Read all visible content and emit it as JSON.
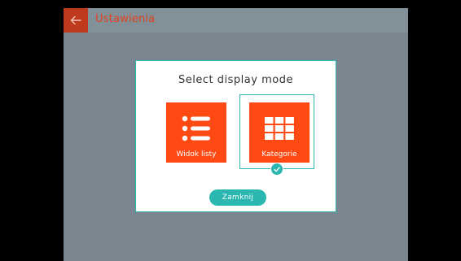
{
  "header": {
    "back_icon": "arrow-left-icon",
    "title": "Ustawienia"
  },
  "dialog": {
    "title": "Select display mode",
    "options": [
      {
        "label": "Widok listy",
        "icon": "list-icon",
        "selected": false
      },
      {
        "label": "Kategorie",
        "icon": "grid-icon",
        "selected": true
      }
    ],
    "selected_icon": "checkmark-icon",
    "close_label": "Zamknij"
  },
  "colors": {
    "accent": "#ff4a14",
    "header_accent": "#bf3a1c",
    "teal": "#2ab7b0",
    "overlay": "#7a8790"
  }
}
